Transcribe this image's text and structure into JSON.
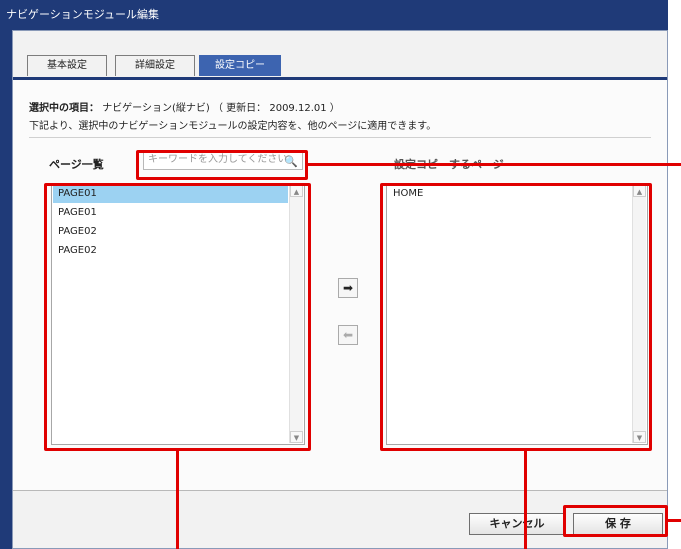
{
  "window": {
    "title": "ナビゲーションモジュール編集"
  },
  "tabs": [
    {
      "label": "基本設定",
      "active": false
    },
    {
      "label": "詳細設定",
      "active": false
    },
    {
      "label": "設定コピー",
      "active": true
    }
  ],
  "info": {
    "selected_label": "選択中の項目：",
    "selected_value": "ナビゲーション(縦ナビ) （ 更新日：",
    "updated_date": "2009.12.01",
    "suffix": "）",
    "description": "下記より、選択中のナビゲーションモジュールの設定内容を、他のページに適用できます。"
  },
  "left": {
    "title": "ページ一覧",
    "search_placeholder": "キーワードを入力してください",
    "items": [
      "PAGE01",
      "PAGE01",
      "PAGE02",
      "PAGE02"
    ],
    "selected_index": 0
  },
  "right": {
    "title": "設定コピーするページ",
    "items": [
      "HOME"
    ]
  },
  "buttons": {
    "cancel": "キャンセル",
    "save": "保 存",
    "move_right": "➡",
    "move_left": "⬅"
  },
  "colors": {
    "title_bar": "#1f3a78",
    "active_tab": "#3d64b0",
    "selection": "#9cd2f2",
    "highlight": "#e00000"
  }
}
